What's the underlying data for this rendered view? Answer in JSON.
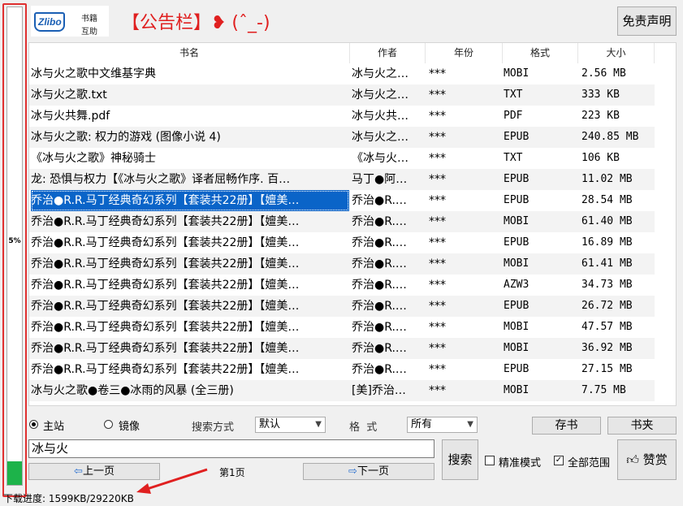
{
  "progress": {
    "label": "5%",
    "fraction": 0.05
  },
  "logo": {
    "brand": "Zlibo",
    "line1": "书籍",
    "line2": "互助"
  },
  "notice": "【公告栏】❥ (ˆ_-)",
  "disclaimer_button": "免责声明",
  "table": {
    "headers": {
      "title": "书名",
      "author": "作者",
      "year": "年份",
      "format": "格式",
      "size": "大小"
    },
    "rows": [
      {
        "title": "冰与火之歌中文维基字典",
        "author": "冰与火之…",
        "year": "***",
        "format": "MOBI",
        "size": "2.56 MB"
      },
      {
        "title": "冰与火之歌.txt",
        "author": "冰与火之…",
        "year": "***",
        "format": "TXT",
        "size": "333 KB"
      },
      {
        "title": "冰与火共舞.pdf",
        "author": "冰与火共…",
        "year": "***",
        "format": "PDF",
        "size": "223 KB"
      },
      {
        "title": "冰与火之歌: 权力的游戏 (图像小说 4)",
        "author": "冰与火之…",
        "year": "***",
        "format": "EPUB",
        "size": "240.85 MB"
      },
      {
        "title": "《冰与火之歌》神秘骑士",
        "author": "《冰与火…",
        "year": "***",
        "format": "TXT",
        "size": "106 KB"
      },
      {
        "title": "龙: 恐惧与权力【《冰与火之歌》译者屈畅作序. 百…",
        "author": "马丁●阿…",
        "year": "***",
        "format": "EPUB",
        "size": "11.02 MB"
      },
      {
        "title": "乔治●R.R.马丁经典奇幻系列【套装共22册】【嬗美…",
        "author": "乔治●R.…",
        "year": "***",
        "format": "EPUB",
        "size": "28.54 MB"
      },
      {
        "title": "乔治●R.R.马丁经典奇幻系列【套装共22册】【嬗美…",
        "author": "乔治●R.…",
        "year": "***",
        "format": "MOBI",
        "size": "61.40 MB"
      },
      {
        "title": "乔治●R.R.马丁经典奇幻系列【套装共22册】【嬗美…",
        "author": "乔治●R.…",
        "year": "***",
        "format": "EPUB",
        "size": "16.89 MB"
      },
      {
        "title": "乔治●R.R.马丁经典奇幻系列【套装共22册】【嬗美…",
        "author": "乔治●R.…",
        "year": "***",
        "format": "MOBI",
        "size": "61.41 MB"
      },
      {
        "title": "乔治●R.R.马丁经典奇幻系列【套装共22册】【嬗美…",
        "author": "乔治●R.…",
        "year": "***",
        "format": "AZW3",
        "size": "34.73 MB"
      },
      {
        "title": "乔治●R.R.马丁经典奇幻系列【套装共22册】【嬗美…",
        "author": "乔治●R.…",
        "year": "***",
        "format": "EPUB",
        "size": "26.72 MB"
      },
      {
        "title": "乔治●R.R.马丁经典奇幻系列【套装共22册】【嬗美…",
        "author": "乔治●R.…",
        "year": "***",
        "format": "MOBI",
        "size": "47.57 MB"
      },
      {
        "title": "乔治●R.R.马丁经典奇幻系列【套装共22册】【嬗美…",
        "author": "乔治●R.…",
        "year": "***",
        "format": "MOBI",
        "size": "36.92 MB"
      },
      {
        "title": "乔治●R.R.马丁经典奇幻系列【套装共22册】【嬗美…",
        "author": "乔治●R.…",
        "year": "***",
        "format": "EPUB",
        "size": "27.15 MB"
      },
      {
        "title": "冰与火之歌●卷三●冰雨的风暴 (全三册)",
        "author": "[美]乔治…",
        "year": "***",
        "format": "MOBI",
        "size": "7.75 MB"
      }
    ],
    "selected_index": 6
  },
  "source": {
    "main": "主站",
    "mirror": "镜像",
    "selected": "main"
  },
  "search_mode": {
    "label": "搜索方式",
    "value": "默认"
  },
  "format_filter": {
    "label": "格  式",
    "value": "所有"
  },
  "buttons": {
    "bookshelf": "存书",
    "bookclip": "书夹",
    "search": "搜索",
    "prev": "上一页",
    "next": "下一页",
    "reward": "赞赏"
  },
  "search": {
    "value": "冰与火"
  },
  "page_label": "第1页",
  "options": {
    "exact": "精准模式",
    "exact_checked": false,
    "full": "全部范围",
    "full_checked": true
  },
  "status": "下载进度: 1599KB/29220KB",
  "colors": {
    "accent": "#e02020",
    "selection": "#0a64c8",
    "progress": "#1db34a",
    "arrow": "#0a64c8"
  }
}
